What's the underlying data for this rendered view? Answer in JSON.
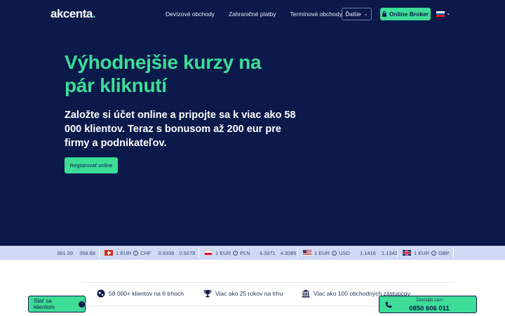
{
  "brand": {
    "logo_text": "akcenta",
    "logo_dot": "."
  },
  "nav": {
    "links": [
      "Devízové obchody",
      "Zahraničné platby",
      "Termínové obchody"
    ],
    "more_label": "Ďalšie",
    "broker_label": "Online Broker",
    "language": "SK"
  },
  "hero": {
    "headline": "Výhodnejšie kurzy na pár kliknutí",
    "subheadline": "Založte si účet online a pripojte sa k viac ako 58 000 klientov. Teraz s bonusom až 200 eur pre firmy a podnikateľov.",
    "cta_label": "Registrovať online"
  },
  "ticker": {
    "partial": {
      "buy": "361.30",
      "sell": "358.88"
    },
    "rates": [
      {
        "flag": "CH",
        "pair_from": "1 EUR",
        "pair_to": "CHF",
        "buy": "0.9338",
        "sell": "0.9278"
      },
      {
        "flag": "PL",
        "pair_from": "1 EUR",
        "pair_to": "PLN",
        "buy": "4.3371",
        "sell": "4.3085"
      },
      {
        "flag": "US",
        "pair_from": "1 EUR",
        "pair_to": "USD",
        "buy": "1.1416",
        "sell": "1.1343"
      },
      {
        "flag": "GB",
        "pair_from": "1 EUR",
        "pair_to": "GBP",
        "buy": "",
        "sell": ""
      }
    ]
  },
  "stats": [
    {
      "icon": "globe-icon",
      "text": "58 000+ klientov na 6 trhoch"
    },
    {
      "icon": "trophy-icon",
      "text": "Viac ako 25 rokov na trhu"
    },
    {
      "icon": "bank-icon",
      "text": "Viac ako 100 obchodných zástupcov"
    }
  ],
  "floating": {
    "client_label": "Stať sa klientom",
    "call_label": "Zavolajte nám",
    "call_number": "0850 606 011"
  },
  "colors": {
    "navy": "#0b1a4a",
    "green": "#3ddc97",
    "ticker_bg": "#cfd9f3"
  }
}
